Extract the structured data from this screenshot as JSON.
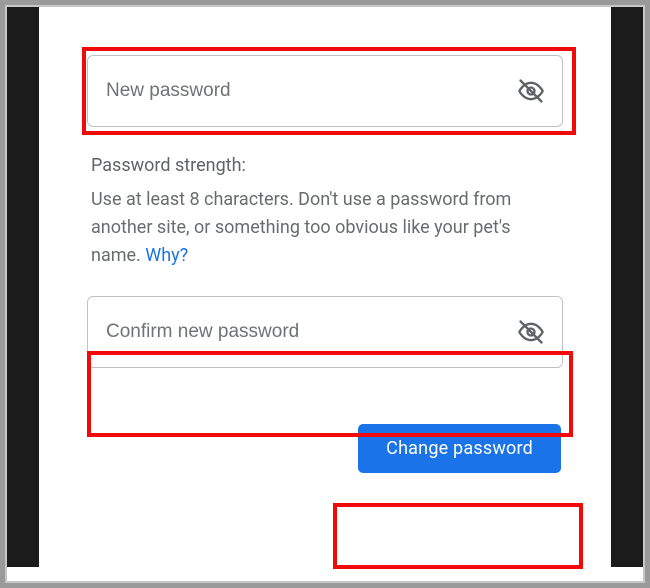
{
  "form": {
    "new_password_placeholder": "New password",
    "confirm_password_placeholder": "Confirm new password",
    "strength_title": "Password strength:",
    "strength_description": "Use at least 8 characters. Don't use a password from another site, or something too obvious like your pet's name. ",
    "why_link_text": "Why?",
    "change_button_label": "Change password"
  },
  "icons": {
    "visibility_off": "visibility-off-icon"
  },
  "colors": {
    "accent": "#1a73e8",
    "highlight": "#f00a0a",
    "text_muted": "#5f6368",
    "border": "#bfc2c5"
  }
}
